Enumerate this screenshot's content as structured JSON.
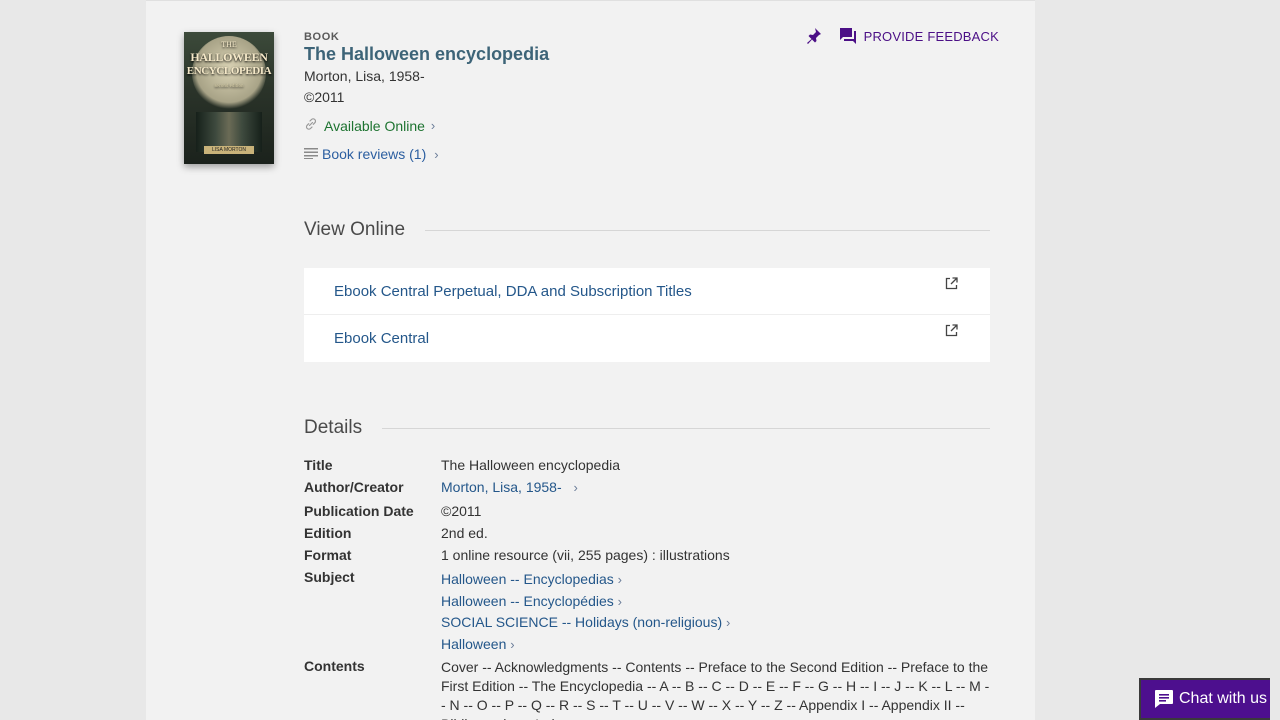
{
  "record": {
    "type": "BOOK",
    "title": "The Halloween encyclopedia",
    "author": "Morton, Lisa, 1958-",
    "date": "©2011",
    "availability": "Available Online",
    "reviews": "Book reviews (1)"
  },
  "cover": {
    "line1": "THE",
    "line2": "HALLOWEEN",
    "line3": "ENCYCLOPEDIA",
    "line4": "second edition",
    "author": "LISA MORTON"
  },
  "actions": {
    "feedback_label": "PROVIDE FEEDBACK"
  },
  "view_online": {
    "heading": "View Online",
    "links": [
      "Ebook Central Perpetual, DDA and Subscription Titles",
      "Ebook Central"
    ]
  },
  "details": {
    "heading": "Details",
    "title_label": "Title",
    "title_value": "The Halloween encyclopedia",
    "author_label": "Author/Creator",
    "author_value": "Morton, Lisa, 1958-",
    "pubdate_label": "Publication Date",
    "pubdate_value": "©2011",
    "edition_label": "Edition",
    "edition_value": "2nd ed.",
    "format_label": "Format",
    "format_value": "1 online resource (vii, 255 pages) : illustrations",
    "subject_label": "Subject",
    "subjects": [
      "Halloween -- Encyclopedias",
      "Halloween -- Encyclopédies",
      "SOCIAL SCIENCE -- Holidays (non-religious)",
      "Halloween"
    ],
    "contents_label": "Contents",
    "contents_value": "Cover -- Acknowledgments -- Contents -- Preface to the Second Edition -- Preface to the First Edition -- The Encyclopedia -- A -- B -- C -- D -- E -- F -- G -- H -- I -- J -- K -- L -- M -- N -- O -- P -- Q -- R -- S -- T -- U -- V -- W -- X -- Y -- Z -- Appendix I -- Appendix II -- Bibliography -- Index."
  },
  "chat": {
    "label": "Chat with us"
  },
  "colors": {
    "title": "#3d6478",
    "link": "#24578a",
    "available": "#1d7330",
    "accent": "#4b0f86"
  }
}
